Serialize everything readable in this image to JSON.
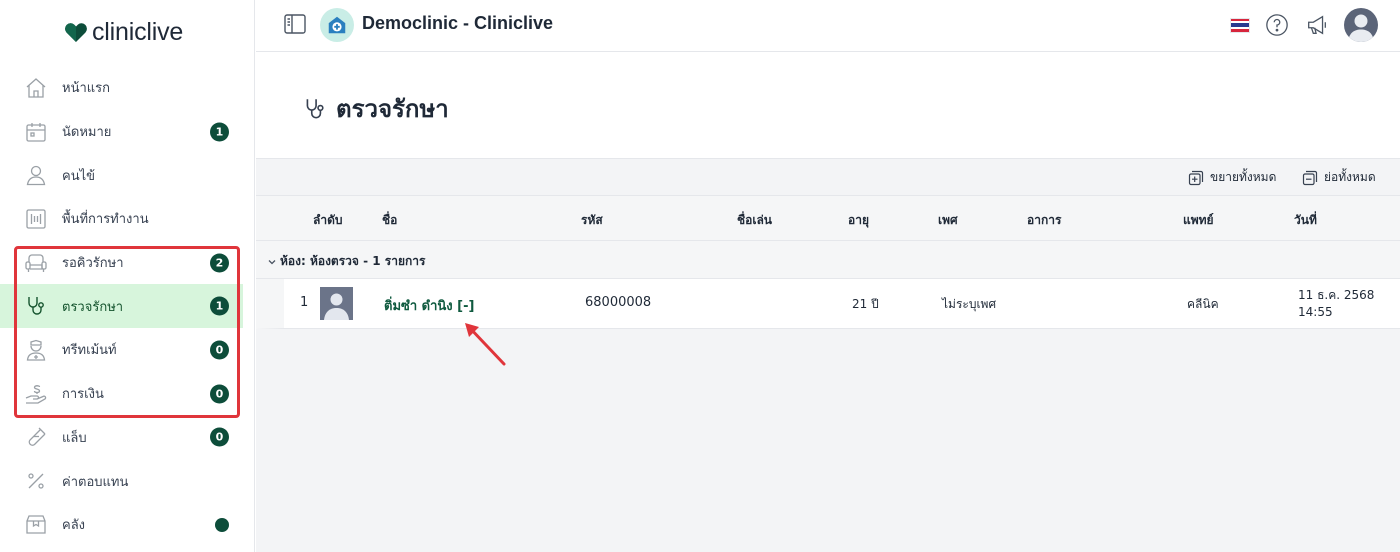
{
  "app": {
    "logo_text": "cliniclive",
    "clinic_name": "Democlinic - Cliniclive"
  },
  "sidebar": {
    "items": [
      {
        "label": "หน้าแรก",
        "icon": "home-icon"
      },
      {
        "label": "นัดหมาย",
        "icon": "calendar-icon",
        "badge": "1"
      },
      {
        "label": "คนไข้",
        "icon": "user-icon"
      },
      {
        "label": "พื้นที่การทำงาน",
        "icon": "workspace-icon"
      },
      {
        "label": "รอคิวรักษา",
        "icon": "sofa-icon",
        "badge": "2"
      },
      {
        "label": "ตรวจรักษา",
        "icon": "stethoscope-icon",
        "badge": "1"
      },
      {
        "label": "ทรีทเม้นท์",
        "icon": "nurse-icon",
        "badge": "0"
      },
      {
        "label": "การเงิน",
        "icon": "money-hand-icon",
        "badge": "0"
      },
      {
        "label": "แล็บ",
        "icon": "test-tube-icon",
        "badge": "0"
      },
      {
        "label": "ค่าตอบแทน",
        "icon": "percent-icon"
      },
      {
        "label": "คลัง",
        "icon": "box-icon"
      }
    ],
    "active": "ตรวจรักษา"
  },
  "page": {
    "title": "ตรวจรักษา",
    "expand_all": "ขยายทั้งหมด",
    "collapse_all": "ย่อทั้งหมด"
  },
  "table": {
    "columns": [
      "ลำดับ",
      "ชื่อ",
      "รหัส",
      "ชื่อเล่น",
      "อายุ",
      "เพศ",
      "อาการ",
      "แพทย์",
      "วันที่"
    ],
    "group_label": "ห้อง: ห้องตรวจ - 1 รายการ",
    "rows": [
      {
        "index": "1",
        "name": "ติ่มซำ ดำนิง [-]",
        "code": "68000008",
        "nickname": "",
        "age": "21 ปี",
        "gender": "ไม่ระบุเพศ",
        "symptom": "",
        "doctor": "คลีนิค",
        "date": "11 ธ.ค. 2568",
        "time": "14:55"
      }
    ]
  },
  "colors": {
    "brand_dark": "#0d4d3a",
    "active_bg": "#d7f5dc",
    "highlight": "#e0353b"
  }
}
